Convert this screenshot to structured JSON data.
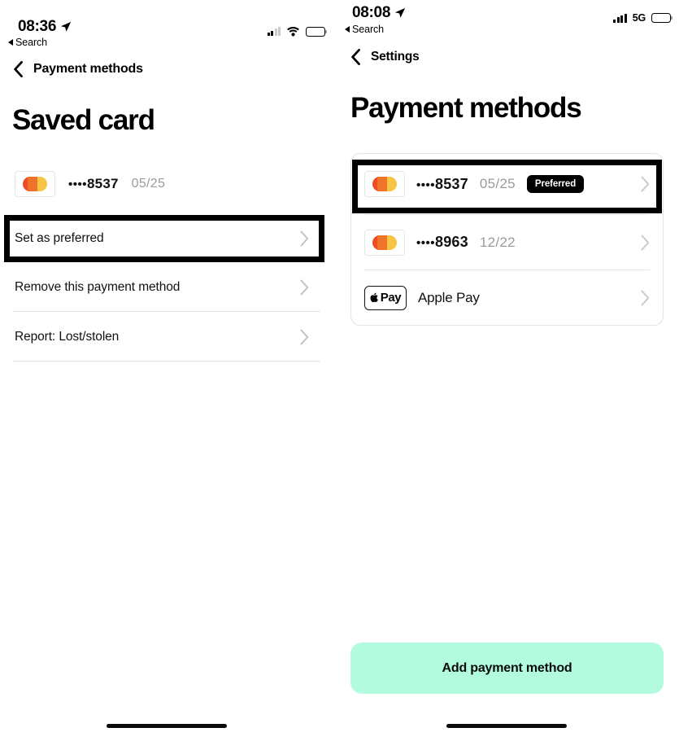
{
  "theme": {
    "accent_mint": "#B3FBDF",
    "badge_bg": "#000000",
    "mastercard_red": "#EF4B24",
    "mastercard_yellow": "#F8C444",
    "muted_text": "#9B9B9B",
    "divider": "#E3E3E3"
  },
  "left_screen": {
    "status_bar": {
      "time": "08:36",
      "back_app": "Search",
      "signal_icon": "cellular-bars-icon",
      "signal_bars_filled": 2,
      "signal_bars_total": 4,
      "wifi_icon": "wifi-icon",
      "battery_icon": "battery-icon"
    },
    "nav": {
      "back_icon": "chevron-left-icon",
      "title": "Payment methods"
    },
    "page_title": "Saved card",
    "card": {
      "logo": "mastercard-icon",
      "dots": "••••",
      "last4": "8537",
      "expiry": "05/25"
    },
    "actions": [
      {
        "label": "Set as preferred",
        "chevron": "chevron-right-icon",
        "highlighted": true
      },
      {
        "label": "Remove this payment method",
        "chevron": "chevron-right-icon",
        "highlighted": false
      },
      {
        "label": "Report: Lost/stolen",
        "chevron": "chevron-right-icon",
        "highlighted": false
      }
    ],
    "home_indicator": "home-indicator"
  },
  "right_screen": {
    "status_bar": {
      "time": "08:08",
      "back_app": "Search",
      "signal_icon": "cellular-bars-icon",
      "signal_bars_filled": 4,
      "signal_bars_total": 4,
      "network": "5G",
      "battery_icon": "battery-icon"
    },
    "nav": {
      "back_icon": "chevron-left-icon",
      "title": "Settings"
    },
    "page_title": "Payment methods",
    "methods": [
      {
        "type": "card",
        "logo": "mastercard-icon",
        "dots": "••••",
        "last4": "8537",
        "expiry": "05/25",
        "badge": "Preferred",
        "chevron": "chevron-right-icon",
        "highlighted": true
      },
      {
        "type": "card",
        "logo": "mastercard-icon",
        "dots": "••••",
        "last4": "8963",
        "expiry": "12/22",
        "badge": "",
        "chevron": "chevron-right-icon",
        "highlighted": false
      },
      {
        "type": "wallet",
        "logo": "apple-pay-icon",
        "logo_text": "Pay",
        "name": "Apple Pay",
        "chevron": "chevron-right-icon",
        "highlighted": false
      }
    ],
    "add_button": "Add payment method",
    "home_indicator": "home-indicator"
  }
}
